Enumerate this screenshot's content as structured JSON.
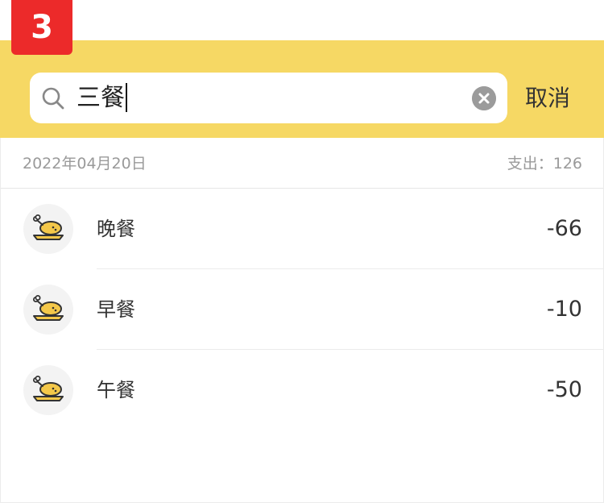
{
  "badge": {
    "number": "3"
  },
  "search": {
    "query": "三餐",
    "cancel_label": "取消"
  },
  "icons": {
    "search": "search-icon",
    "clear": "clear-icon",
    "category": "roast-chicken-icon"
  },
  "colors": {
    "header_bg": "#f6d864",
    "badge_bg": "#ec2a2a",
    "icon_fill": "#f4c84a"
  },
  "day_group": {
    "date": "2022年04月20日",
    "expense_label": "支出：",
    "expense_total": "126"
  },
  "entries": [
    {
      "name": "晚餐",
      "amount": "-66"
    },
    {
      "name": "早餐",
      "amount": "-10"
    },
    {
      "name": "午餐",
      "amount": "-50"
    }
  ]
}
